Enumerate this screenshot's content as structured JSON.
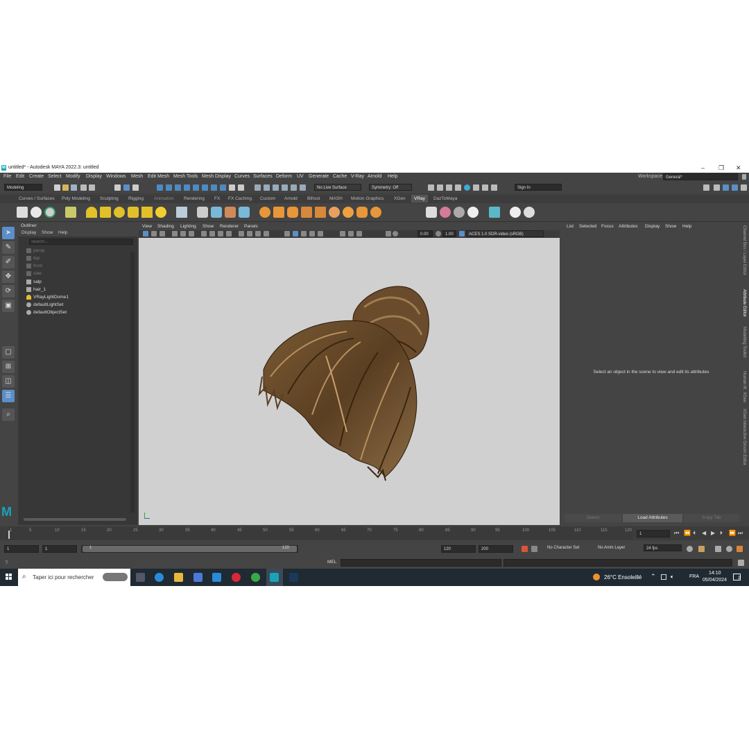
{
  "window": {
    "title": "untitled* - Autodesk MAYA 2022.3: untitled",
    "logo_letter": "M",
    "controls": [
      "–",
      "❐",
      "✕"
    ]
  },
  "menubar": {
    "items": [
      "File",
      "Edit",
      "Create",
      "Select",
      "Modify",
      "Display",
      "Windows",
      "Mesh",
      "Edit Mesh",
      "Mesh Tools",
      "Mesh Display",
      "Curves",
      "Surfaces",
      "Deform",
      "UV",
      "Generate",
      "Cache",
      "V-Ray",
      "Arnold",
      "Help"
    ],
    "workspace_label": "Workspace:",
    "workspace_value": "General*"
  },
  "statusline": {
    "mode": "Modeling",
    "live_surface": "No Live Surface",
    "symmetry": "Symmetry: Off",
    "sign_in": "Sign In"
  },
  "shelf_tabs": [
    "Curves / Surfaces",
    "Poly Modeling",
    "Sculpting",
    "Rigging",
    "Animation",
    "Rendering",
    "FX",
    "FX Caching",
    "Custom",
    "Arnold",
    "Bifrost",
    "MASH",
    "Motion Graphics",
    "XGen",
    "VRay",
    "DazToMaya"
  ],
  "shelf_active": "VRay",
  "outliner": {
    "title": "Outliner",
    "menu": [
      "Display",
      "Show",
      "Help"
    ],
    "search_placeholder": "Search...",
    "items": [
      {
        "label": "persp",
        "dim": true
      },
      {
        "label": "top",
        "dim": true
      },
      {
        "label": "front",
        "dim": true
      },
      {
        "label": "side",
        "dim": true
      },
      {
        "label": "salp",
        "dim": false
      },
      {
        "label": "hair_1",
        "dim": false
      },
      {
        "label": "VRayLightDome1",
        "dim": false
      },
      {
        "label": "defaultLightSet",
        "dim": false
      },
      {
        "label": "defaultObjectSet",
        "dim": false
      }
    ]
  },
  "viewport": {
    "menu": [
      "View",
      "Shading",
      "Lighting",
      "Show",
      "Renderer",
      "Panels"
    ],
    "exposure": "0.00",
    "gamma": "1.00",
    "color_space": "ACES 1.0 SDR-video (sRGB)"
  },
  "attribute_editor": {
    "menu": [
      "List",
      "Selected",
      "Focus",
      "Attributes",
      "Display",
      "Show",
      "Help"
    ],
    "message": "Select an object in the scene to view and edit its attributes",
    "buttons": [
      "Select",
      "Load Attributes",
      "Copy Tab"
    ]
  },
  "side_tabs": [
    "Channel Box / Layer Editor",
    "Attribute Editor",
    "Modelling Toolkit",
    "Human IK",
    "XGen",
    "XGen Interactive Groom Editor"
  ],
  "timeline": {
    "ticks": [
      "1",
      "5",
      "10",
      "15",
      "20",
      "25",
      "30",
      "35",
      "40",
      "45",
      "50",
      "55",
      "60",
      "65",
      "70",
      "75",
      "80",
      "85",
      "90",
      "95",
      "100",
      "105",
      "110",
      "115",
      "120"
    ],
    "current_frame": "1",
    "range_start": "1",
    "range_inner_start": "1",
    "slider_start": "1",
    "slider_end": "120",
    "range_end": "120",
    "anim_end": "200",
    "character_set": "No Character Set",
    "anim_layer": "No Anim Layer",
    "fps": "24 fps"
  },
  "cmdline": {
    "mode": "MEL"
  },
  "taskbar": {
    "search_placeholder": "Taper ici pour rechercher",
    "weather": "26°C  Ensoleillé",
    "language": "FRA",
    "time": "14:10",
    "date": "05/04/2024",
    "notifications": "2"
  }
}
